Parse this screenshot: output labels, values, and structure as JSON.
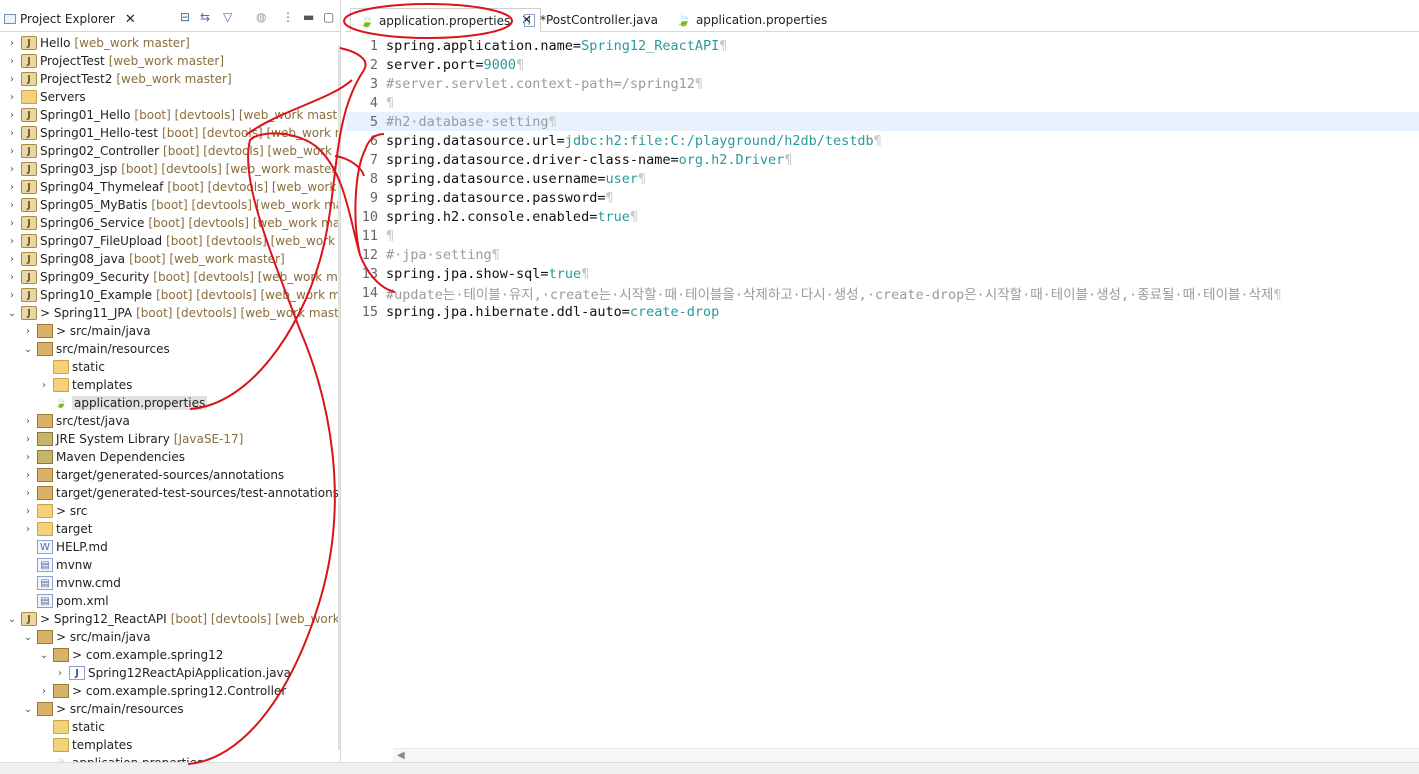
{
  "explorer": {
    "title": "Project Explorer",
    "items": [
      {
        "arrow": "›",
        "icon": "M",
        "label": "Hello",
        "dec": "[web_work master]",
        "indent": 0
      },
      {
        "arrow": "›",
        "icon": "M",
        "label": "ProjectTest",
        "dec": "[web_work master]",
        "indent": 0
      },
      {
        "arrow": "›",
        "icon": "M",
        "label": "ProjectTest2",
        "dec": "[web_work master]",
        "indent": 0
      },
      {
        "arrow": "›",
        "icon": "F",
        "label": "Servers",
        "dec": "",
        "indent": 0
      },
      {
        "arrow": "›",
        "icon": "M",
        "label": "Spring01_Hello",
        "dec": "[boot] [devtools] [web_work master]",
        "indent": 0
      },
      {
        "arrow": "›",
        "icon": "M",
        "label": "Spring01_Hello-test",
        "dec": "[boot] [devtools] [web_work mast",
        "indent": 0
      },
      {
        "arrow": "›",
        "icon": "M",
        "label": "Spring02_Controller",
        "dec": "[boot] [devtools] [web_work mas",
        "indent": 0
      },
      {
        "arrow": "›",
        "icon": "M",
        "label": "Spring03_jsp",
        "dec": "[boot] [devtools] [web_work master]",
        "indent": 0
      },
      {
        "arrow": "›",
        "icon": "M",
        "label": "Spring04_Thymeleaf",
        "dec": "[boot] [devtools] [web_work mas",
        "indent": 0
      },
      {
        "arrow": "›",
        "icon": "M",
        "label": "Spring05_MyBatis",
        "dec": "[boot] [devtools] [web_work master",
        "indent": 0
      },
      {
        "arrow": "›",
        "icon": "M",
        "label": "Spring06_Service",
        "dec": "[boot] [devtools] [web_work master",
        "indent": 0
      },
      {
        "arrow": "›",
        "icon": "M",
        "label": "Spring07_FileUpload",
        "dec": "[boot] [devtools] [web_work mas",
        "indent": 0
      },
      {
        "arrow": "›",
        "icon": "M",
        "label": "Spring08_java",
        "dec": "[boot] [web_work master]",
        "indent": 0
      },
      {
        "arrow": "›",
        "icon": "M",
        "label": "Spring09_Security",
        "dec": "[boot] [devtools] [web_work maste",
        "indent": 0
      },
      {
        "arrow": "›",
        "icon": "M",
        "label": "Spring10_Example",
        "dec": "[boot] [devtools] [web_work maste",
        "indent": 0
      },
      {
        "arrow": "⌄",
        "icon": "M",
        "label": "> Spring11_JPA",
        "dec": "[boot] [devtools] [web_work master]",
        "indent": 0
      },
      {
        "arrow": "›",
        "icon": "P",
        "label": "> src/main/java",
        "dec": "",
        "indent": 1
      },
      {
        "arrow": "⌄",
        "icon": "P",
        "label": "src/main/resources",
        "dec": "",
        "indent": 1
      },
      {
        "arrow": "",
        "icon": "F",
        "label": "static",
        "dec": "",
        "indent": 2
      },
      {
        "arrow": "›",
        "icon": "F",
        "label": "templates",
        "dec": "",
        "indent": 2
      },
      {
        "arrow": "",
        "icon": "L",
        "label": "application.properties",
        "dec": "",
        "indent": 2,
        "sel": true
      },
      {
        "arrow": "›",
        "icon": "P",
        "label": "src/test/java",
        "dec": "",
        "indent": 1
      },
      {
        "arrow": "›",
        "icon": "B",
        "label": "JRE System Library",
        "dec": "[JavaSE-17]",
        "indent": 1
      },
      {
        "arrow": "›",
        "icon": "B",
        "label": "Maven Dependencies",
        "dec": "",
        "indent": 1
      },
      {
        "arrow": "›",
        "icon": "P",
        "label": "target/generated-sources/annotations",
        "dec": "",
        "indent": 1
      },
      {
        "arrow": "›",
        "icon": "P",
        "label": "target/generated-test-sources/test-annotations",
        "dec": "",
        "indent": 1
      },
      {
        "arrow": "›",
        "icon": "F",
        "label": "> src",
        "dec": "",
        "indent": 1
      },
      {
        "arrow": "›",
        "icon": "F",
        "label": "target",
        "dec": "",
        "indent": 1
      },
      {
        "arrow": "",
        "icon": "W",
        "label": "HELP.md",
        "dec": "",
        "indent": 1
      },
      {
        "arrow": "",
        "icon": "D",
        "label": "mvnw",
        "dec": "",
        "indent": 1
      },
      {
        "arrow": "",
        "icon": "D",
        "label": "mvnw.cmd",
        "dec": "",
        "indent": 1
      },
      {
        "arrow": "",
        "icon": "D",
        "label": "pom.xml",
        "dec": "",
        "indent": 1
      },
      {
        "arrow": "⌄",
        "icon": "M",
        "label": "> Spring12_ReactAPI",
        "dec": "[boot] [devtools] [web_work ma",
        "indent": 0
      },
      {
        "arrow": "⌄",
        "icon": "P",
        "label": "> src/main/java",
        "dec": "",
        "indent": 1
      },
      {
        "arrow": "⌄",
        "icon": "K",
        "label": "> com.example.spring12",
        "dec": "",
        "indent": 2
      },
      {
        "arrow": "›",
        "icon": "J",
        "label": "Spring12ReactApiApplication.java",
        "dec": "",
        "indent": 3
      },
      {
        "arrow": "›",
        "icon": "K",
        "label": "> com.example.spring12.Controller",
        "dec": "",
        "indent": 2
      },
      {
        "arrow": "⌄",
        "icon": "P",
        "label": "> src/main/resources",
        "dec": "",
        "indent": 1
      },
      {
        "arrow": "",
        "icon": "F",
        "label": "static",
        "dec": "",
        "indent": 2
      },
      {
        "arrow": "",
        "icon": "F",
        "label": "templates",
        "dec": "",
        "indent": 2
      },
      {
        "arrow": "",
        "icon": "L",
        "label": "application.properties",
        "dec": "",
        "indent": 2
      }
    ]
  },
  "editor": {
    "tabs": [
      {
        "label": "application.properties",
        "icon": "leaf",
        "active": true,
        "close": "✕"
      },
      {
        "label": "*PostController.java",
        "icon": "java",
        "active": false
      },
      {
        "label": "application.properties",
        "icon": "leaf",
        "active": false
      }
    ],
    "lines": [
      {
        "n": "1",
        "parts": [
          [
            "k",
            "spring.application.name="
          ],
          [
            "v",
            "Spring12_ReactAPI"
          ],
          [
            "p",
            "¶"
          ]
        ]
      },
      {
        "n": "2",
        "parts": [
          [
            "k",
            "server.port="
          ],
          [
            "v",
            "9000"
          ],
          [
            "p",
            "¶"
          ]
        ]
      },
      {
        "n": "3",
        "parts": [
          [
            "c",
            "#server.servlet.context-path=/spring12"
          ],
          [
            "p",
            "¶"
          ]
        ]
      },
      {
        "n": "4",
        "parts": [
          [
            "p",
            "¶"
          ]
        ]
      },
      {
        "n": "5",
        "parts": [
          [
            "c",
            "#h2·database·setting"
          ],
          [
            "p",
            "¶"
          ]
        ],
        "cur": true
      },
      {
        "n": "6",
        "parts": [
          [
            "k",
            "spring.datasource.url="
          ],
          [
            "v",
            "jdbc:h2:file:C:/playground/h2db/testdb"
          ],
          [
            "p",
            "¶"
          ]
        ]
      },
      {
        "n": "7",
        "parts": [
          [
            "k",
            "spring.datasource.driver-class-name="
          ],
          [
            "v",
            "org.h2.Driver"
          ],
          [
            "p",
            "¶"
          ]
        ]
      },
      {
        "n": "8",
        "parts": [
          [
            "k",
            "spring.datasource.username="
          ],
          [
            "v",
            "user"
          ],
          [
            "p",
            "¶"
          ]
        ]
      },
      {
        "n": "9",
        "parts": [
          [
            "k",
            "spring.datasource.password="
          ],
          [
            "p",
            "¶"
          ]
        ]
      },
      {
        "n": "10",
        "parts": [
          [
            "k",
            "spring.h2.console.enabled="
          ],
          [
            "v",
            "true"
          ],
          [
            "p",
            "¶"
          ]
        ]
      },
      {
        "n": "11",
        "parts": [
          [
            "p",
            "¶"
          ]
        ]
      },
      {
        "n": "12",
        "parts": [
          [
            "c",
            "#·jpa·setting"
          ],
          [
            "p",
            "¶"
          ]
        ]
      },
      {
        "n": "13",
        "parts": [
          [
            "k",
            "spring.jpa.show-sql="
          ],
          [
            "v",
            "true"
          ],
          [
            "p",
            "¶"
          ]
        ]
      },
      {
        "n": "14",
        "parts": [
          [
            "c",
            "#update는·테이블·유지,·create는·시작할·때·테이블을·삭제하고·다시·생성,·create-drop은·시작할·때·테이블·생성,·종료될·때·테이블·삭제"
          ],
          [
            "p",
            "¶"
          ]
        ]
      },
      {
        "n": "15",
        "parts": [
          [
            "k",
            "spring.jpa.hibernate.ddl-auto="
          ],
          [
            "v",
            "create-drop"
          ]
        ]
      }
    ]
  },
  "colors": {
    "annotation": "#d9141b",
    "value": "#2a9a9a",
    "comment": "#9b9b9b",
    "current_line": "#e8f2fe"
  }
}
